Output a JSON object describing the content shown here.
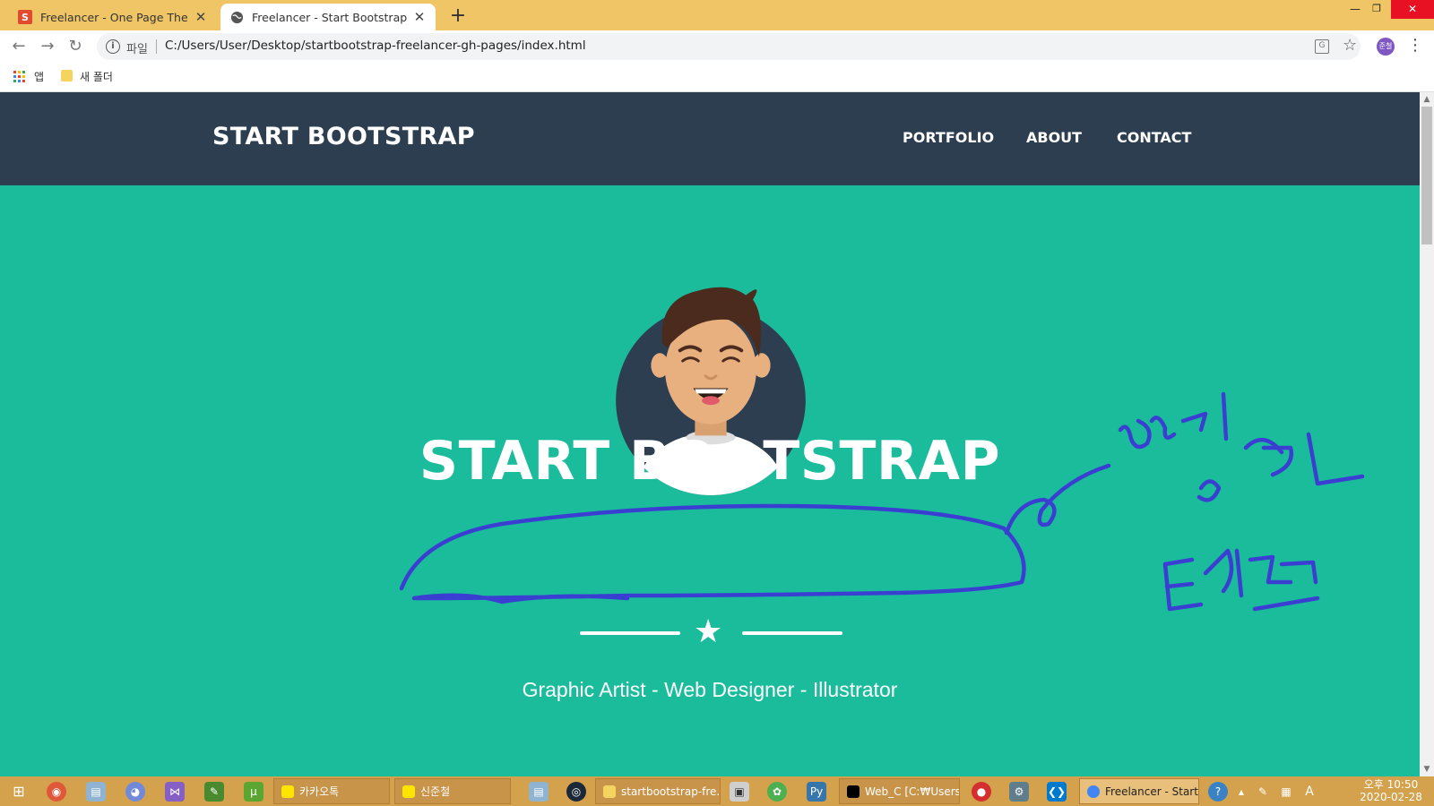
{
  "browser": {
    "tabs": [
      {
        "title": "Freelancer - One Page Theme -",
        "favicon": "s-logo",
        "active": false
      },
      {
        "title": "Freelancer - Start Bootstrap The",
        "favicon": "globe-icon",
        "active": true
      }
    ],
    "address_bar": {
      "scheme_label": "파일",
      "url": "C:/Users/User/Desktop/startbootstrap-freelancer-gh-pages/index.html"
    },
    "profile_initials": "준철",
    "bookmarks": [
      {
        "label": "앱",
        "icon": "apps-grid-icon"
      },
      {
        "label": "새 폴더",
        "icon": "folder-icon"
      }
    ]
  },
  "site": {
    "brand": "START BOOTSTRAP",
    "nav": [
      "PORTFOLIO",
      "ABOUT",
      "CONTACT"
    ],
    "hero": {
      "title": "START BOOTSTRAP",
      "subtitle": "Graphic Artist - Web Designer - Illustrator",
      "divider_icon": "star-icon"
    }
  },
  "taskbar": {
    "tasks": [
      {
        "label": "카카오톡"
      },
      {
        "label": "신준철"
      },
      {
        "label": "startbootstrap-fre..."
      },
      {
        "label": "Web_C [C:₩Users..."
      },
      {
        "label": "Freelancer - Start...",
        "active": true
      }
    ],
    "clock": {
      "ampm_time": "오후 10:50",
      "date": "2020-02-28"
    }
  },
  "colors": {
    "hero_bg": "#1abc9c",
    "nav_bg": "#2c3e50",
    "tab_strip": "#f0c565",
    "ink": "#3b3fd1"
  }
}
